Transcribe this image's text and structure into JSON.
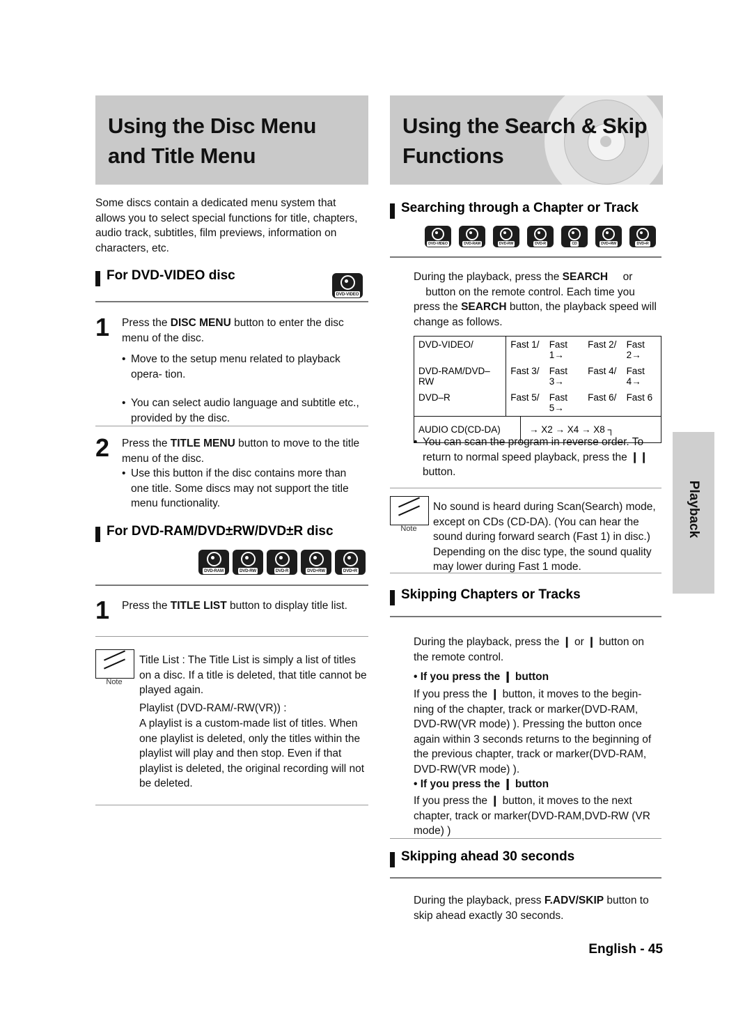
{
  "page_number": "English - 45",
  "side_tab": "Playback",
  "left": {
    "header_line1": "Using the Disc Menu",
    "header_line2": "and Title Menu",
    "intro": "Some discs contain a dedicated menu system that allows you to select special functions for title, chapters, audio track, subtitles, film previews, information on characters, etc.",
    "section1_title": "For DVD-VIDEO disc",
    "section1_badge": "DVD-VIDEO",
    "step1_num": "1",
    "step1_text": "Press the DISC MENU button to enter the disc menu of the disc.",
    "step1_text_bold": "DISC MENU",
    "step1_bullets": [
      "Move to the setup menu related to playback opera- tion.",
      "You can select audio language and subtitle etc., provided by the disc."
    ],
    "step2_num": "2",
    "step2_text": "Press the TITLE MENU button to move to the title menu of the disc.",
    "step2_text_bold": "TITLE MENU",
    "step2_bullets": [
      "Use this button if the disc contains more than one title. Some discs may not support the title menu functionality."
    ],
    "section2_title": "For DVD-RAM/DVD±RW/DVD±R disc",
    "section2_badges": [
      "DVD-RAM",
      "DVD-RW",
      "DVD-R",
      "DVD+RW",
      "DVD+R"
    ],
    "step3_num": "1",
    "step3_text": "Press the TITLE LIST button to display title list.",
    "step3_text_bold": "TITLE LIST",
    "note_label": "Note",
    "note_text_1": "Title List : The Title List is simply a list of titles on a disc. If a title is deleted, that title cannot be played again.",
    "note_text_2": "Playlist (DVD-RAM/-RW(VR)) :",
    "note_text_3": "A playlist is a custom-made list of titles. When one playlist is deleted, only the titles within the playlist will play and then stop. Even if that playlist is deleted, the original recording will not be deleted."
  },
  "right": {
    "header_line1": "Using the Search & Skip",
    "header_line2": "Functions",
    "section1_title": "Searching through a Chapter or Track",
    "section1_badges": [
      "DVD-VIDEO",
      "DVD-RAM",
      "DVD-RW",
      "DVD-R",
      "CD",
      "DVD+RW",
      "DVD+R"
    ],
    "para1": "During the playback, press the SEARCH          or          button on the remote control. Each time you press the SEARCH button, the playback speed will change as follows.",
    "para1_bold": "SEARCH",
    "table": {
      "rows": [
        {
          "label": "DVD-VIDEO/",
          "cells": [
            "Fast 1/",
            "Fast 1→",
            "Fast 2/",
            "Fast 2→"
          ]
        },
        {
          "label": "DVD-RAM/DVD–RW",
          "cells": [
            "Fast 3/",
            "Fast 3→",
            "Fast 4/",
            "Fast 4→"
          ]
        },
        {
          "label": "DVD–R",
          "cells": [
            "Fast 5/",
            "Fast 5→",
            "Fast 6/",
            "Fast 6"
          ]
        }
      ],
      "audio_label": "AUDIO CD(CD-DA)",
      "audio_value": "→ X2 → X4 → X8 ┐"
    },
    "bullet1": "You can scan the program in reverse order. To return to normal speed playback, press the ❙❙ button.",
    "note_label": "Note",
    "note_text": "No sound is heard during Scan(Search) mode, except on CDs (CD-DA). (You can hear the sound during forward search (Fast 1) in disc.) Depending on the disc type, the sound quality may lower during Fast 1 mode.",
    "section2_title": "Skipping Chapters or Tracks",
    "para2": "During the playback, press the ❙        or        ❙ button on the remote control.",
    "sub1_title": "• If you press the ❙        button",
    "sub1_text": "If you press the ❙        button, it moves to the begin- ning of the chapter, track or marker(DVD-RAM, DVD-RW(VR mode) ). Pressing the button once again within 3 seconds returns to the beginning of the previous chapter, track or marker(DVD-RAM, DVD-RW(VR mode) ).",
    "sub2_title": "• If you press the        ❙ button",
    "sub2_text": "If you press the        ❙ button, it moves to the next chapter, track or marker(DVD-RAM,DVD-RW (VR mode) )",
    "section3_title": "Skipping ahead 30 seconds",
    "para3": "During the playback, press F.ADV/SKIP button to skip ahead exactly 30 seconds.",
    "para3_bold": "F.ADV/SKIP"
  }
}
